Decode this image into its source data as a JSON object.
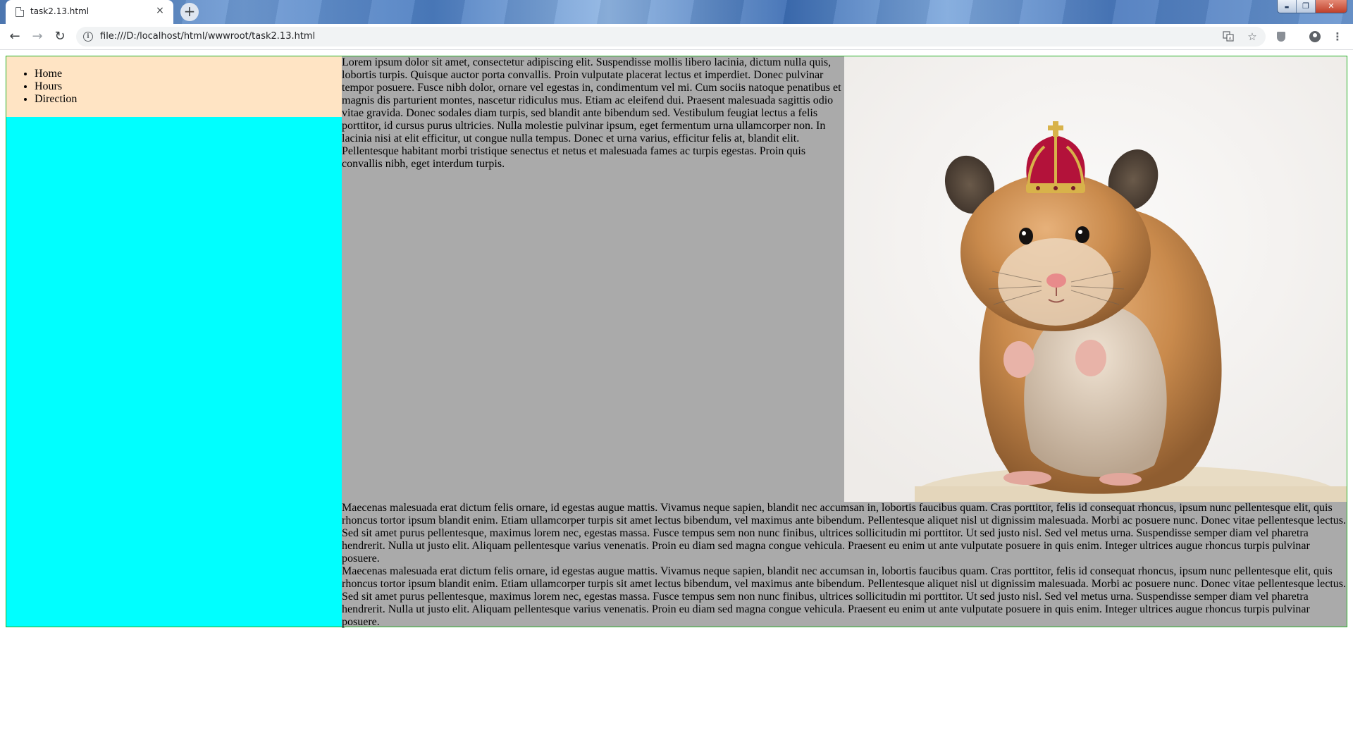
{
  "browser": {
    "tab_title": "task2.13.html",
    "tab_close": "×",
    "new_tab": "+",
    "url": "file:///D:/localhost/html/wwwroot/task2.13.html",
    "back": "←",
    "forward": "→",
    "reload": "↻",
    "window_controls": {
      "minimize": "▬",
      "maximize": "❐",
      "close": "✕"
    }
  },
  "nav": {
    "items": [
      {
        "label": "Home"
      },
      {
        "label": "Hours"
      },
      {
        "label": "Direction"
      }
    ]
  },
  "content": {
    "intro": "Lorem ipsum dolor sit amet, consectetur adipiscing elit. Suspendisse mollis libero lacinia, dictum nulla quis, lobortis turpis. Quisque auctor porta convallis. Proin vulputate placerat lectus et imperdiet. Donec pulvinar tempor posuere. Fusce nibh dolor, ornare vel egestas in, condimentum vel mi. Cum sociis natoque penatibus et magnis dis parturient montes, nascetur ridiculus mus. Etiam ac eleifend dui. Praesent malesuada sagittis odio vitae gravida. Donec sodales diam turpis, sed blandit ante bibendum sed. Vestibulum feugiat lectus a felis porttitor, id cursus purus ultricies. Nulla molestie pulvinar ipsum, eget fermentum urna ullamcorper non. In lacinia nisi at elit efficitur, ut congue nulla tempus. Donec et urna varius, efficitur felis at, blandit elit. Pellentesque habitant morbi tristique senectus et netus et malesuada fames ac turpis egestas. Proin quis convallis nibh, eget interdum turpis.",
    "paragraph_1": "Maecenas malesuada erat dictum felis ornare, id egestas augue mattis. Vivamus neque sapien, blandit nec accumsan in, lobortis faucibus quam. Cras porttitor, felis id consequat rhoncus, ipsum nunc pellentesque elit, quis rhoncus tortor ipsum blandit enim. Etiam ullamcorper turpis sit amet lectus bibendum, vel maximus ante bibendum. Pellentesque aliquet nisl ut dignissim malesuada. Morbi ac posuere nunc. Donec vitae pellentesque lectus. Sed sit amet purus pellentesque, maximus lorem nec, egestas massa. Fusce tempus sem non nunc finibus, ultrices sollicitudin mi porttitor. Ut sed justo nisl. Sed vel metus urna. Suspendisse semper diam vel pharetra hendrerit. Nulla ut justo elit. Aliquam pellentesque varius venenatis. Proin eu diam sed magna congue vehicula. Praesent eu enim ut ante vulputate posuere in quis enim. Integer ultrices augue rhoncus turpis pulvinar posuere.",
    "paragraph_2": "Maecenas malesuada erat dictum felis ornare, id egestas augue mattis. Vivamus neque sapien, blandit nec accumsan in, lobortis faucibus quam. Cras porttitor, felis id consequat rhoncus, ipsum nunc pellentesque elit, quis rhoncus tortor ipsum blandit enim. Etiam ullamcorper turpis sit amet lectus bibendum, vel maximus ante bibendum. Pellentesque aliquet nisl ut dignissim malesuada. Morbi ac posuere nunc. Donec vitae pellentesque lectus. Sed sit amet purus pellentesque, maximus lorem nec, egestas massa. Fusce tempus sem non nunc finibus, ultrices sollicitudin mi porttitor. Ut sed justo nisl. Sed vel metus urna. Suspendisse semper diam vel pharetra hendrerit. Nulla ut justo elit. Aliquam pellentesque varius venenatis. Proin eu diam sed magna congue vehicula. Praesent eu enim ut ante vulputate posuere in quis enim. Integer ultrices augue rhoncus turpis pulvinar posuere."
  },
  "colors": {
    "sidebar": "#00ffff",
    "nav_box": "#ffe4c4",
    "content": "#aaaaaa",
    "border": "#28b128"
  },
  "icons": [
    "document-icon",
    "info-icon",
    "translate-icon",
    "star-icon",
    "shield-extension-icon",
    "profile-icon",
    "menu-icon"
  ]
}
